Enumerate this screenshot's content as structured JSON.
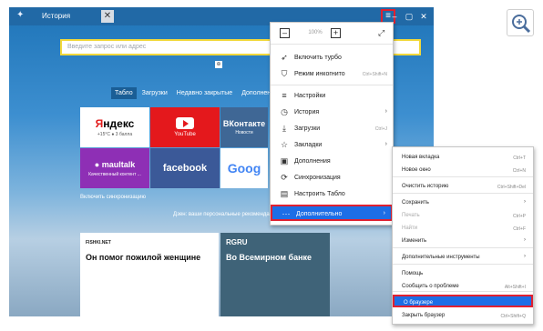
{
  "window": {
    "title": "История",
    "tab_close": "✕"
  },
  "search": {
    "placeholder": "Введите запрос или адрес"
  },
  "tabs": [
    {
      "label": "Табло"
    },
    {
      "label": "Загрузки"
    },
    {
      "label": "Недавно закрытые"
    },
    {
      "label": "Дополнения"
    }
  ],
  "tiles": {
    "yandex": {
      "logo_first": "Я",
      "logo_rest": "ндекс",
      "sub": "+15°C  ● 3 балла"
    },
    "youtube": {
      "label": "YouTube"
    },
    "vk": {
      "label": "ВКонтакте",
      "sub": "Новости"
    },
    "mail": {
      "label": "● maultalk",
      "sub": "Качественный контент ..."
    },
    "facebook": {
      "label": "facebook"
    },
    "google": {
      "label": "Goog"
    }
  },
  "sync_text": "Включить синхронизацию",
  "hint_text": "Дзен: ваши персональные рекомендации",
  "cards": [
    {
      "tag": "FISHKI.NET",
      "title": "Он помог пожилой женщине"
    },
    {
      "tag": "RGRU",
      "title": "Во Всемирном банке"
    }
  ],
  "menu_main": {
    "zoom": "100%",
    "items": [
      {
        "icon": "rocket-icon",
        "label": "Включить турбо",
        "shortcut": "",
        "arrow": ""
      },
      {
        "icon": "incognito-icon",
        "label": "Режим инкогнито",
        "shortcut": "Ctrl+Shift+N",
        "arrow": ""
      },
      {
        "icon": "settings-icon",
        "label": "Настройки",
        "shortcut": "",
        "arrow": ""
      },
      {
        "icon": "history-icon",
        "label": "История",
        "shortcut": "",
        "arrow": "›"
      },
      {
        "icon": "download-icon",
        "label": "Загрузки",
        "shortcut": "Ctrl+J",
        "arrow": ""
      },
      {
        "icon": "bookmark-icon",
        "label": "Закладки",
        "shortcut": "",
        "arrow": "›"
      },
      {
        "icon": "extensions-icon",
        "label": "Дополнения",
        "shortcut": "",
        "arrow": ""
      },
      {
        "icon": "sync-icon",
        "label": "Синхронизация",
        "shortcut": "",
        "arrow": ""
      },
      {
        "icon": "tableau-icon",
        "label": "Настроить Табло",
        "shortcut": "",
        "arrow": ""
      },
      {
        "icon": "more-icon",
        "label": "Дополнительно",
        "shortcut": "",
        "arrow": "›"
      }
    ]
  },
  "menu_more": {
    "items": [
      {
        "label": "Новая вкладка",
        "shortcut": "Ctrl+T"
      },
      {
        "label": "Новое окно",
        "shortcut": "Ctrl+N"
      },
      {
        "label": "Очистить историю",
        "shortcut": "Ctrl+Shift+Del"
      },
      {
        "label": "Сохранить",
        "shortcut": "›"
      },
      {
        "label": "Печать",
        "shortcut": "Ctrl+P"
      },
      {
        "label": "Найти",
        "shortcut": "Ctrl+F"
      },
      {
        "label": "Изменить",
        "shortcut": "›"
      },
      {
        "label": "Дополнительные инструменты",
        "shortcut": "›"
      },
      {
        "label": "Помощь",
        "shortcut": ""
      },
      {
        "label": "Сообщить о проблеме",
        "shortcut": "Alt+Shift+I"
      },
      {
        "label": "О браузере",
        "shortcut": ""
      },
      {
        "label": "Закрыть браузер",
        "shortcut": "Ctrl+Shift+Q"
      }
    ]
  },
  "colors": {
    "highlight": "#1d6ee6",
    "annotation": "#e02030",
    "titlebar": "#2169a6"
  }
}
